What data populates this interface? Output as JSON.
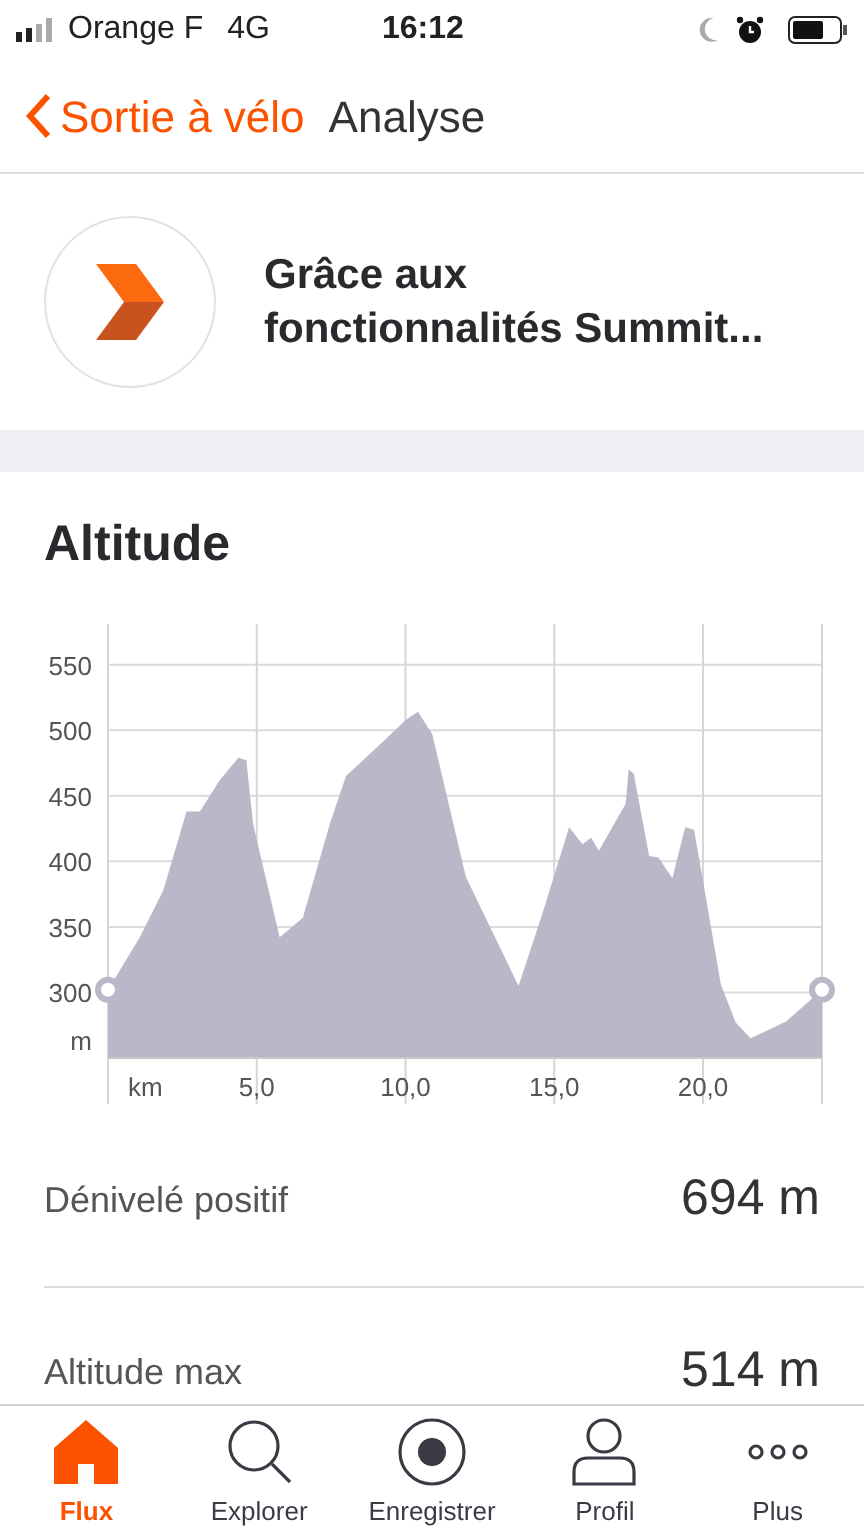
{
  "status_bar": {
    "carrier": "Orange F",
    "network": "4G",
    "time": "16:12"
  },
  "nav": {
    "back_label": "Sortie à vélo",
    "title": "Analyse"
  },
  "banner": {
    "text": "Grâce aux fonctionnalités Summit..."
  },
  "section": {
    "title": "Altitude",
    "chart_data": {
      "type": "area",
      "grid": true,
      "xlabel": "km",
      "ylabel": "m",
      "xlim": [
        0,
        24
      ],
      "ylim": [
        250,
        581
      ],
      "x": [
        0,
        1.07,
        1.86,
        2.64,
        3.09,
        3.76,
        4.38,
        4.65,
        4.88,
        5.77,
        6.55,
        7.45,
        8.0,
        8.57,
        9.13,
        10.02,
        10.42,
        10.9,
        12.03,
        13.8,
        14.6,
        15.5,
        15.95,
        16.24,
        16.5,
        17.4,
        17.5,
        17.67,
        18.19,
        18.5,
        18.97,
        19.4,
        19.7,
        20.1,
        20.6,
        21.1,
        21.6,
        22.8,
        24.0
      ],
      "series": [
        {
          "color": "#b9b8c8",
          "values": [
            302,
            342,
            378,
            438,
            438,
            462,
            479,
            477,
            428,
            342,
            357,
            428,
            465,
            477,
            489,
            508,
            514,
            497,
            388,
            305,
            360,
            426,
            413,
            418,
            408,
            444,
            470,
            467,
            404,
            403,
            387,
            426,
            424,
            372,
            306,
            277,
            265,
            278,
            302
          ]
        }
      ],
      "xticks": [
        {
          "value": 5,
          "label": "5,0"
        },
        {
          "value": 10,
          "label": "10,0"
        },
        {
          "value": 15,
          "label": "15,0"
        },
        {
          "value": 20,
          "label": "20,0"
        }
      ],
      "yticks": [
        300,
        350,
        400,
        450,
        500,
        550
      ]
    }
  },
  "stats": [
    {
      "label": "Dénivelé positif",
      "value": "694 m"
    },
    {
      "label": "Altitude max",
      "value": "514 m"
    }
  ],
  "tab_bar": [
    {
      "kind": "home",
      "label": "Flux",
      "selected": true
    },
    {
      "kind": "search",
      "label": "Explorer",
      "selected": false
    },
    {
      "kind": "record",
      "label": "Enregistrer",
      "selected": false
    },
    {
      "kind": "profile",
      "label": "Profil",
      "selected": false
    },
    {
      "kind": "more",
      "label": "Plus",
      "selected": false
    }
  ]
}
